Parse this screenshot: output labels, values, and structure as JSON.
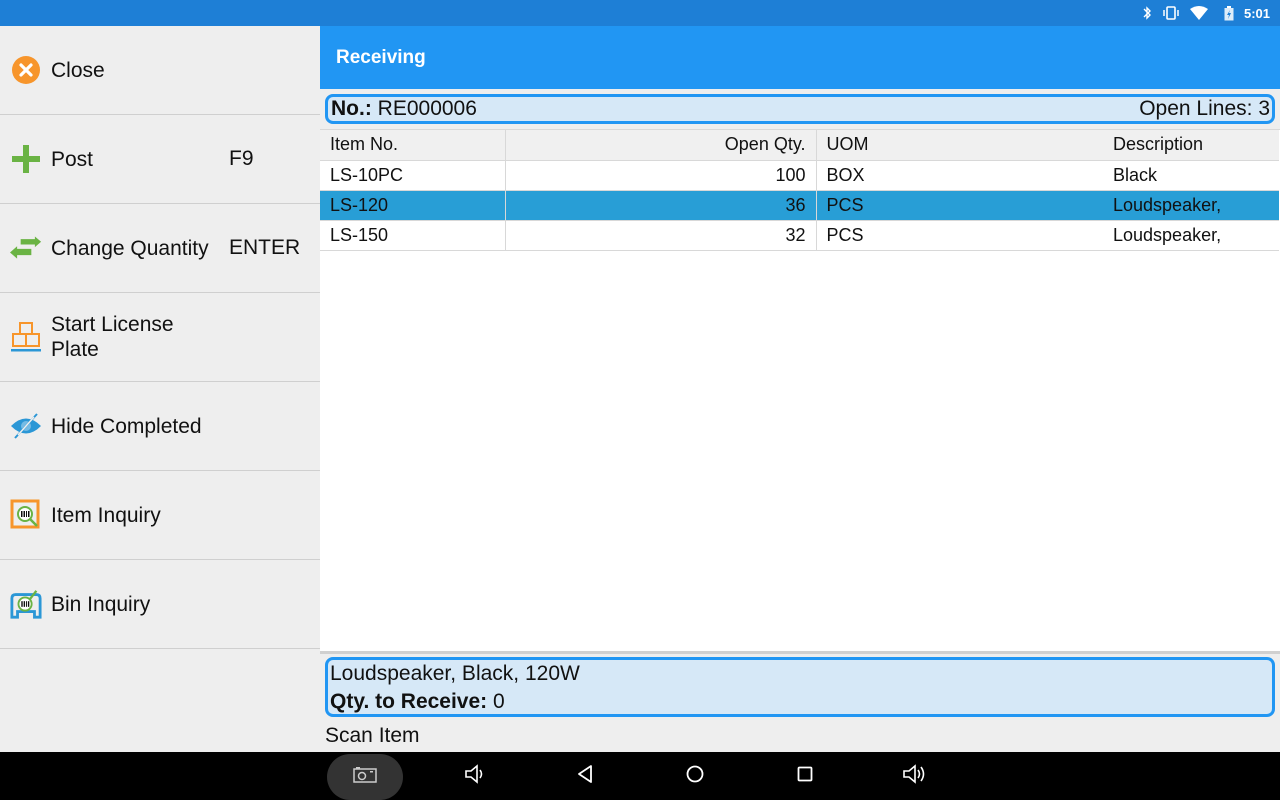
{
  "status_bar": {
    "time": "5:01",
    "icons": [
      "bluetooth-icon",
      "vibrate-icon",
      "wifi-icon",
      "battery-charging-icon"
    ]
  },
  "sidebar": {
    "items": [
      {
        "label": "Close",
        "shortcut": "",
        "icon": "close-circle-icon"
      },
      {
        "label": "Post",
        "shortcut": "F9",
        "icon": "plus-icon"
      },
      {
        "label": "Change Quantity",
        "shortcut": "ENTER",
        "icon": "swap-arrows-icon"
      },
      {
        "label": "Start License Plate",
        "shortcut": "",
        "icon": "license-plate-boxes-icon"
      },
      {
        "label": "Hide Completed",
        "shortcut": "",
        "icon": "eye-off-icon"
      },
      {
        "label": "Item Inquiry",
        "shortcut": "",
        "icon": "item-inquiry-icon"
      },
      {
        "label": "Bin Inquiry",
        "shortcut": "",
        "icon": "bin-inquiry-icon"
      }
    ]
  },
  "header": {
    "title": "Receiving"
  },
  "document": {
    "no_label": "No.:",
    "no_value": "RE000006",
    "open_lines_label": "Open Lines:",
    "open_lines_value": "3"
  },
  "table": {
    "columns": [
      "Item No.",
      "Open Qty.",
      "UOM",
      "Description"
    ],
    "rows": [
      {
        "item_no": "LS-10PC",
        "open_qty": "100",
        "uom": "BOX",
        "description": "Black",
        "selected": false
      },
      {
        "item_no": "LS-120",
        "open_qty": "36",
        "uom": "PCS",
        "description": "Loudspeaker,",
        "selected": true
      },
      {
        "item_no": "LS-150",
        "open_qty": "32",
        "uom": "PCS",
        "description": "Loudspeaker,",
        "selected": false
      }
    ]
  },
  "details": {
    "description": "Loudspeaker, Black, 120W",
    "qty_label": "Qty. to Receive:",
    "qty_value": "0"
  },
  "scan": {
    "label": "Scan Item"
  },
  "nav_bar": {
    "buttons": [
      "screenshot-icon",
      "volume-down-icon",
      "back-icon",
      "home-icon",
      "recents-icon",
      "volume-up-icon"
    ]
  },
  "colors": {
    "status_bar": "#1e7fd6",
    "app_bar": "#2196f3",
    "selected_row": "#289ed6",
    "info_box_bg": "#d6e8f7",
    "accent_orange": "#f7952b",
    "accent_green": "#6ab344",
    "accent_blue": "#2b97d6"
  }
}
